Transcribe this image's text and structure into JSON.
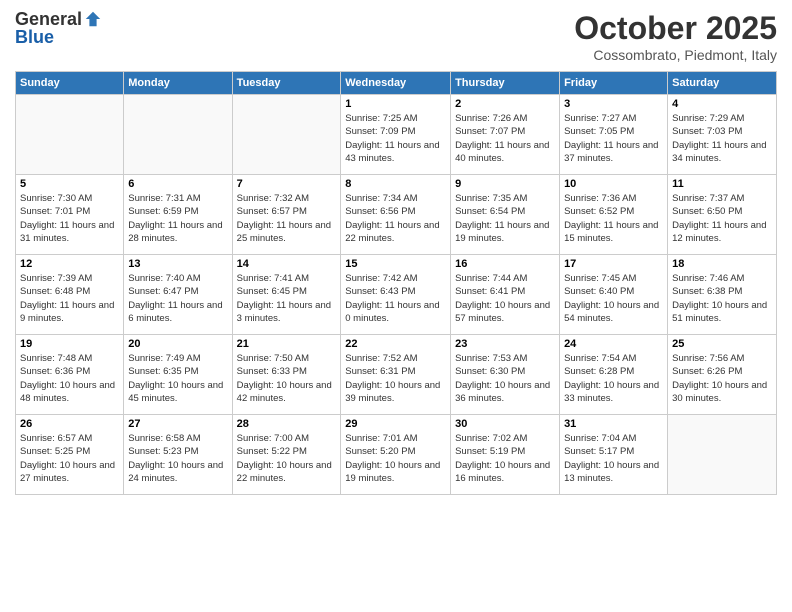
{
  "header": {
    "logo_general": "General",
    "logo_blue": "Blue",
    "month": "October 2025",
    "location": "Cossombrato, Piedmont, Italy"
  },
  "days_of_week": [
    "Sunday",
    "Monday",
    "Tuesday",
    "Wednesday",
    "Thursday",
    "Friday",
    "Saturday"
  ],
  "weeks": [
    [
      {
        "num": "",
        "info": ""
      },
      {
        "num": "",
        "info": ""
      },
      {
        "num": "",
        "info": ""
      },
      {
        "num": "1",
        "info": "Sunrise: 7:25 AM\nSunset: 7:09 PM\nDaylight: 11 hours and 43 minutes."
      },
      {
        "num": "2",
        "info": "Sunrise: 7:26 AM\nSunset: 7:07 PM\nDaylight: 11 hours and 40 minutes."
      },
      {
        "num": "3",
        "info": "Sunrise: 7:27 AM\nSunset: 7:05 PM\nDaylight: 11 hours and 37 minutes."
      },
      {
        "num": "4",
        "info": "Sunrise: 7:29 AM\nSunset: 7:03 PM\nDaylight: 11 hours and 34 minutes."
      }
    ],
    [
      {
        "num": "5",
        "info": "Sunrise: 7:30 AM\nSunset: 7:01 PM\nDaylight: 11 hours and 31 minutes."
      },
      {
        "num": "6",
        "info": "Sunrise: 7:31 AM\nSunset: 6:59 PM\nDaylight: 11 hours and 28 minutes."
      },
      {
        "num": "7",
        "info": "Sunrise: 7:32 AM\nSunset: 6:57 PM\nDaylight: 11 hours and 25 minutes."
      },
      {
        "num": "8",
        "info": "Sunrise: 7:34 AM\nSunset: 6:56 PM\nDaylight: 11 hours and 22 minutes."
      },
      {
        "num": "9",
        "info": "Sunrise: 7:35 AM\nSunset: 6:54 PM\nDaylight: 11 hours and 19 minutes."
      },
      {
        "num": "10",
        "info": "Sunrise: 7:36 AM\nSunset: 6:52 PM\nDaylight: 11 hours and 15 minutes."
      },
      {
        "num": "11",
        "info": "Sunrise: 7:37 AM\nSunset: 6:50 PM\nDaylight: 11 hours and 12 minutes."
      }
    ],
    [
      {
        "num": "12",
        "info": "Sunrise: 7:39 AM\nSunset: 6:48 PM\nDaylight: 11 hours and 9 minutes."
      },
      {
        "num": "13",
        "info": "Sunrise: 7:40 AM\nSunset: 6:47 PM\nDaylight: 11 hours and 6 minutes."
      },
      {
        "num": "14",
        "info": "Sunrise: 7:41 AM\nSunset: 6:45 PM\nDaylight: 11 hours and 3 minutes."
      },
      {
        "num": "15",
        "info": "Sunrise: 7:42 AM\nSunset: 6:43 PM\nDaylight: 11 hours and 0 minutes."
      },
      {
        "num": "16",
        "info": "Sunrise: 7:44 AM\nSunset: 6:41 PM\nDaylight: 10 hours and 57 minutes."
      },
      {
        "num": "17",
        "info": "Sunrise: 7:45 AM\nSunset: 6:40 PM\nDaylight: 10 hours and 54 minutes."
      },
      {
        "num": "18",
        "info": "Sunrise: 7:46 AM\nSunset: 6:38 PM\nDaylight: 10 hours and 51 minutes."
      }
    ],
    [
      {
        "num": "19",
        "info": "Sunrise: 7:48 AM\nSunset: 6:36 PM\nDaylight: 10 hours and 48 minutes."
      },
      {
        "num": "20",
        "info": "Sunrise: 7:49 AM\nSunset: 6:35 PM\nDaylight: 10 hours and 45 minutes."
      },
      {
        "num": "21",
        "info": "Sunrise: 7:50 AM\nSunset: 6:33 PM\nDaylight: 10 hours and 42 minutes."
      },
      {
        "num": "22",
        "info": "Sunrise: 7:52 AM\nSunset: 6:31 PM\nDaylight: 10 hours and 39 minutes."
      },
      {
        "num": "23",
        "info": "Sunrise: 7:53 AM\nSunset: 6:30 PM\nDaylight: 10 hours and 36 minutes."
      },
      {
        "num": "24",
        "info": "Sunrise: 7:54 AM\nSunset: 6:28 PM\nDaylight: 10 hours and 33 minutes."
      },
      {
        "num": "25",
        "info": "Sunrise: 7:56 AM\nSunset: 6:26 PM\nDaylight: 10 hours and 30 minutes."
      }
    ],
    [
      {
        "num": "26",
        "info": "Sunrise: 6:57 AM\nSunset: 5:25 PM\nDaylight: 10 hours and 27 minutes."
      },
      {
        "num": "27",
        "info": "Sunrise: 6:58 AM\nSunset: 5:23 PM\nDaylight: 10 hours and 24 minutes."
      },
      {
        "num": "28",
        "info": "Sunrise: 7:00 AM\nSunset: 5:22 PM\nDaylight: 10 hours and 22 minutes."
      },
      {
        "num": "29",
        "info": "Sunrise: 7:01 AM\nSunset: 5:20 PM\nDaylight: 10 hours and 19 minutes."
      },
      {
        "num": "30",
        "info": "Sunrise: 7:02 AM\nSunset: 5:19 PM\nDaylight: 10 hours and 16 minutes."
      },
      {
        "num": "31",
        "info": "Sunrise: 7:04 AM\nSunset: 5:17 PM\nDaylight: 10 hours and 13 minutes."
      },
      {
        "num": "",
        "info": ""
      }
    ]
  ]
}
